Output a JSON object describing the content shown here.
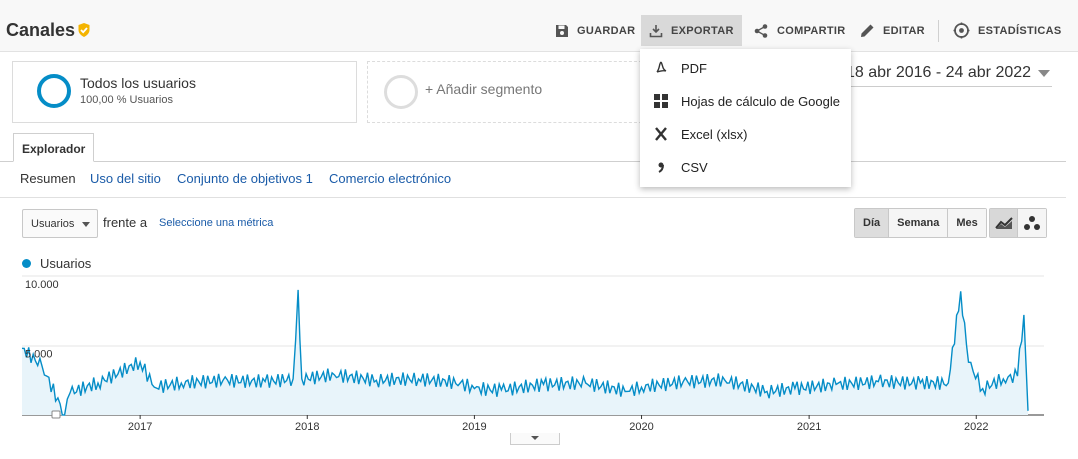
{
  "header": {
    "title": "Canales",
    "buttons": {
      "save": "GUARDAR",
      "export": "EXPORTAR",
      "share": "COMPARTIR",
      "edit": "EDITAR",
      "insights": "ESTADÍSTICAS"
    }
  },
  "segments": {
    "active": {
      "title": "Todos los usuarios",
      "subtitle": "100,00 % Usuarios"
    },
    "add_label": "+ Añadir segmento"
  },
  "date_range": "18 abr 2016 - 24 abr 2022",
  "tabs": {
    "explorer": "Explorador"
  },
  "subnav": [
    "Resumen",
    "Uso del sitio",
    "Conjunto de objetivos 1",
    "Comercio electrónico"
  ],
  "metric": {
    "selected": "Usuarios",
    "versus": "frente a",
    "select_metric": "Seleccione una métrica"
  },
  "period": {
    "day": "Día",
    "week": "Semana",
    "month": "Mes",
    "selected": "Día"
  },
  "export_menu": [
    {
      "label": "PDF",
      "icon": "pdf-icon"
    },
    {
      "label": "Hojas de cálculo de Google",
      "icon": "sheets-icon"
    },
    {
      "label": "Excel (xlsx)",
      "icon": "excel-icon"
    },
    {
      "label": "CSV",
      "icon": "csv-icon"
    }
  ],
  "colors": {
    "series": "#058dc7",
    "fill": "#e8f4fa",
    "accent": "#f4b400"
  },
  "chart_data": {
    "type": "area",
    "series": [
      {
        "name": "Usuarios"
      }
    ],
    "x": [
      "2016-04-18",
      "2016-06-01",
      "2016-07-20",
      "2016-08-01",
      "2016-10-01",
      "2017-01-01",
      "2017-02-01",
      "2017-04-01",
      "2017-07-01",
      "2017-10-01",
      "2017-12-01",
      "2017-12-12",
      "2017-12-20",
      "2018-03-01",
      "2018-06-01",
      "2018-09-01",
      "2018-12-01",
      "2019-01-01",
      "2019-03-01",
      "2019-06-01",
      "2019-09-01",
      "2019-12-01",
      "2020-01-01",
      "2020-04-01",
      "2020-07-01",
      "2020-10-01",
      "2020-12-01",
      "2021-03-01",
      "2021-06-01",
      "2021-09-01",
      "2021-11-01",
      "2021-11-28",
      "2021-12-15",
      "2022-01-15",
      "2022-03-01",
      "2022-04-01",
      "2022-04-15",
      "2022-04-24"
    ],
    "values": [
      4800,
      3500,
      0,
      1600,
      2300,
      3800,
      2000,
      2300,
      2500,
      2400,
      2600,
      9000,
      2600,
      2900,
      2500,
      2600,
      2300,
      1900,
      1800,
      2200,
      2300,
      1700,
      2000,
      2400,
      2500,
      1700,
      1900,
      2200,
      2400,
      2300,
      2300,
      8900,
      3800,
      1900,
      2600,
      2800,
      7200,
      300
    ],
    "y_ticks": [
      "5.000",
      "10.000"
    ],
    "x_ticks": [
      "2017",
      "2018",
      "2019",
      "2020",
      "2021",
      "2022"
    ],
    "ylim": [
      0,
      10000
    ]
  }
}
